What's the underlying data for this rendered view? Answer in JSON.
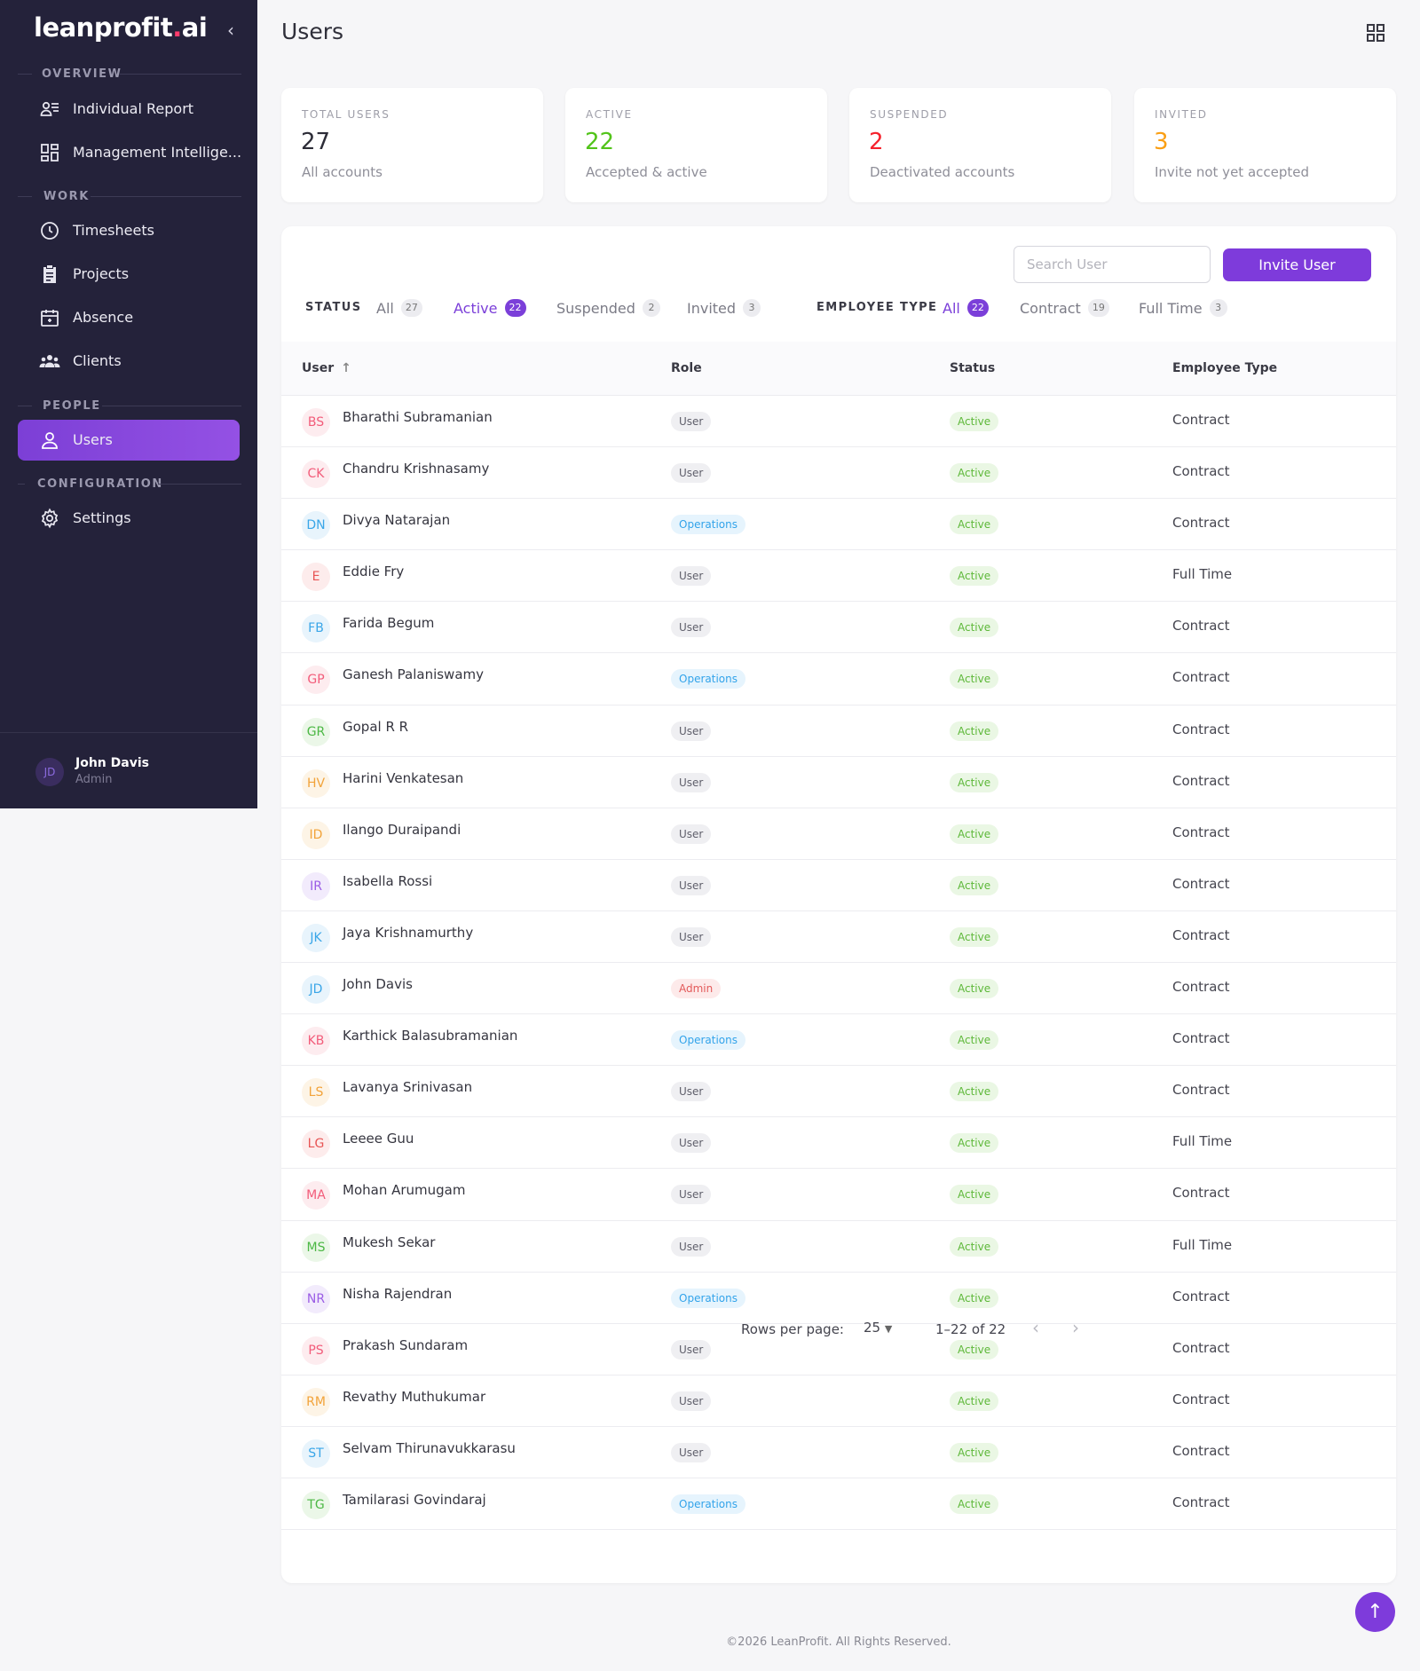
{
  "brand": {
    "name_main": "leanprofit",
    "name_dot": ".",
    "name_tld": "ai"
  },
  "sidebar": {
    "sections": [
      "OVERVIEW",
      "WORK",
      "PEOPLE",
      "CONFIGURATION"
    ],
    "items": [
      {
        "label": "Individual Report",
        "icon": "report-icon"
      },
      {
        "label": "Management Intellige...",
        "icon": "dashboard-icon"
      },
      {
        "label": "Timesheets",
        "icon": "clock-icon"
      },
      {
        "label": "Projects",
        "icon": "clipboard-icon"
      },
      {
        "label": "Absence",
        "icon": "calendar-icon"
      },
      {
        "label": "Clients",
        "icon": "group-icon"
      },
      {
        "label": "Users",
        "icon": "user-icon"
      },
      {
        "label": "Settings",
        "icon": "gear-icon"
      }
    ],
    "user": {
      "initials": "JD",
      "name": "John Davis",
      "role": "Admin"
    }
  },
  "header": {
    "title": "Users"
  },
  "stats": [
    {
      "label": "TOTAL USERS",
      "value": "27",
      "sub": "All accounts",
      "color": "#2d2d38"
    },
    {
      "label": "ACTIVE",
      "value": "22",
      "sub": "Accepted & active",
      "color": "#52c41a"
    },
    {
      "label": "SUSPENDED",
      "value": "2",
      "sub": "Deactivated accounts",
      "color": "#f5222d"
    },
    {
      "label": "INVITED",
      "value": "3",
      "sub": "Invite not yet accepted",
      "color": "#fa9f14"
    }
  ],
  "toolbar": {
    "search_placeholder": "Search User",
    "invite_label": "Invite User"
  },
  "filters": {
    "status_label": "STATUS",
    "status_tabs": [
      {
        "label": "All",
        "count": "27"
      },
      {
        "label": "Active",
        "count": "22"
      },
      {
        "label": "Suspended",
        "count": "2"
      },
      {
        "label": "Invited",
        "count": "3"
      }
    ],
    "type_label": "EMPLOYEE TYPE",
    "type_tabs": [
      {
        "label": "All",
        "count": "22"
      },
      {
        "label": "Contract",
        "count": "19"
      },
      {
        "label": "Full Time",
        "count": "3"
      }
    ]
  },
  "table": {
    "columns": [
      "User",
      "Role",
      "Status",
      "Employee Type"
    ],
    "rows": [
      {
        "initials": "BS",
        "name": "Bharathi Subramanian",
        "role": "User",
        "status": "Active",
        "type": "Contract",
        "color": "#f25c7a",
        "bg": "#fdecef"
      },
      {
        "initials": "CK",
        "name": "Chandru Krishnasamy",
        "role": "User",
        "status": "Active",
        "type": "Contract",
        "color": "#f25c7a",
        "bg": "#fdecef"
      },
      {
        "initials": "DN",
        "name": "Divya Natarajan",
        "role": "Operations",
        "status": "Active",
        "type": "Contract",
        "color": "#3aa6e8",
        "bg": "#e8f4fc"
      },
      {
        "initials": "E",
        "name": "Eddie Fry",
        "role": "User",
        "status": "Active",
        "type": "Full Time",
        "color": "#e85555",
        "bg": "#fdecec"
      },
      {
        "initials": "FB",
        "name": "Farida Begum",
        "role": "User",
        "status": "Active",
        "type": "Contract",
        "color": "#3aa6e8",
        "bg": "#e8f4fc"
      },
      {
        "initials": "GP",
        "name": "Ganesh Palaniswamy",
        "role": "Operations",
        "status": "Active",
        "type": "Contract",
        "color": "#f25c7a",
        "bg": "#fdecef"
      },
      {
        "initials": "GR",
        "name": "Gopal R R",
        "role": "User",
        "status": "Active",
        "type": "Contract",
        "color": "#4cb845",
        "bg": "#ebf7e8"
      },
      {
        "initials": "HV",
        "name": "Harini Venkatesan",
        "role": "User",
        "status": "Active",
        "type": "Contract",
        "color": "#f2a33a",
        "bg": "#fdf4e6"
      },
      {
        "initials": "ID",
        "name": "Ilango Duraipandi",
        "role": "User",
        "status": "Active",
        "type": "Contract",
        "color": "#f2a33a",
        "bg": "#fdf4e6"
      },
      {
        "initials": "IR",
        "name": "Isabella Rossi",
        "role": "User",
        "status": "Active",
        "type": "Contract",
        "color": "#9b5de5",
        "bg": "#f2ebfc"
      },
      {
        "initials": "JK",
        "name": "Jaya Krishnamurthy",
        "role": "User",
        "status": "Active",
        "type": "Contract",
        "color": "#3aa6e8",
        "bg": "#e8f4fc"
      },
      {
        "initials": "JD",
        "name": "John Davis",
        "role": "Admin",
        "status": "Active",
        "type": "Contract",
        "color": "#3aa6e8",
        "bg": "#e8f4fc"
      },
      {
        "initials": "KB",
        "name": "Karthick Balasubramanian",
        "role": "Operations",
        "status": "Active",
        "type": "Contract",
        "color": "#f25c7a",
        "bg": "#fdecef"
      },
      {
        "initials": "LS",
        "name": "Lavanya Srinivasan",
        "role": "User",
        "status": "Active",
        "type": "Contract",
        "color": "#f2a33a",
        "bg": "#fdf4e6"
      },
      {
        "initials": "LG",
        "name": "Leeee Guu",
        "role": "User",
        "status": "Active",
        "type": "Full Time",
        "color": "#e85555",
        "bg": "#fdecec"
      },
      {
        "initials": "MA",
        "name": "Mohan Arumugam",
        "role": "User",
        "status": "Active",
        "type": "Contract",
        "color": "#f25c7a",
        "bg": "#fdecef"
      },
      {
        "initials": "MS",
        "name": "Mukesh Sekar",
        "role": "User",
        "status": "Active",
        "type": "Full Time",
        "color": "#4cb845",
        "bg": "#ebf7e8"
      },
      {
        "initials": "NR",
        "name": "Nisha Rajendran",
        "role": "Operations",
        "status": "Active",
        "type": "Contract",
        "color": "#9b5de5",
        "bg": "#f2ebfc"
      },
      {
        "initials": "PS",
        "name": "Prakash Sundaram",
        "role": "User",
        "status": "Active",
        "type": "Contract",
        "color": "#f25c7a",
        "bg": "#fdecef"
      },
      {
        "initials": "RM",
        "name": "Revathy Muthukumar",
        "role": "User",
        "status": "Active",
        "type": "Contract",
        "color": "#f2a33a",
        "bg": "#fdf4e6"
      },
      {
        "initials": "ST",
        "name": "Selvam Thirunavukkarasu",
        "role": "User",
        "status": "Active",
        "type": "Contract",
        "color": "#3aa6e8",
        "bg": "#e8f4fc"
      },
      {
        "initials": "TG",
        "name": "Tamilarasi Govindaraj",
        "role": "Operations",
        "status": "Active",
        "type": "Contract",
        "color": "#4cb845",
        "bg": "#ebf7e8"
      }
    ]
  },
  "pagination": {
    "rows_label": "Rows per page:",
    "rows_value": "25",
    "range": "1–22 of 22"
  },
  "footer": {
    "text": "©2026 LeanProfit. All Rights Reserved."
  }
}
